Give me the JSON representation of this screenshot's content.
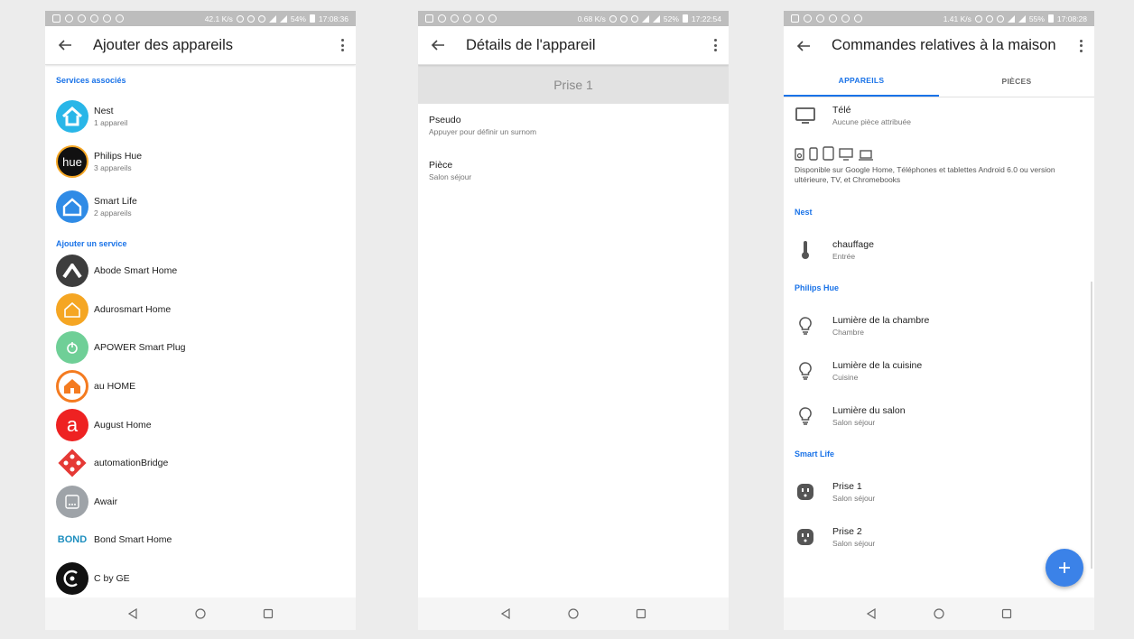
{
  "screens": [
    {
      "status": {
        "speed": "42.1 K/s",
        "battery": "54%",
        "time": "17:08:36"
      },
      "title": "Ajouter des appareils",
      "linked_header": "Services associés",
      "linked": [
        {
          "name": "Nest",
          "sub": "1 appareil",
          "logo_color": "#29b6e8"
        },
        {
          "name": "Philips Hue",
          "sub": "3 appareils",
          "logo_color": "#111111",
          "logo_text": "hue"
        },
        {
          "name": "Smart Life",
          "sub": "2 appareils",
          "logo_color": "#2f8be6"
        }
      ],
      "add_header": "Ajouter un service",
      "services": [
        {
          "name": "Abode Smart Home",
          "logo_color": "#3d3d3d"
        },
        {
          "name": "Adurosmart Home",
          "logo_color": "#f5a623"
        },
        {
          "name": "APOWER Smart Plug",
          "logo_color": "#6fcf97"
        },
        {
          "name": "au HOME",
          "logo_color": "#f47b20"
        },
        {
          "name": "August Home",
          "logo_color": "#ee2222",
          "logo_text": "a"
        },
        {
          "name": "automationBridge",
          "logo_color": "#e53935"
        },
        {
          "name": "Awair",
          "logo_color": "#9ea3a8"
        },
        {
          "name": "Bond Smart Home",
          "logo_text": "BOND",
          "logo_color": "#1f8fbf"
        },
        {
          "name": "C by GE",
          "logo_color": "#111111"
        }
      ]
    },
    {
      "status": {
        "speed": "0.68 K/s",
        "battery": "52%",
        "time": "17:22:54"
      },
      "title": "Détails de l'appareil",
      "device_name": "Prise 1",
      "rows": [
        {
          "title": "Pseudo",
          "sub": "Appuyer pour définir un surnom"
        },
        {
          "title": "Pièce",
          "sub": "Salon séjour"
        }
      ]
    },
    {
      "status": {
        "speed": "1.41 K/s",
        "battery": "55%",
        "time": "17:08:28"
      },
      "title": "Commandes relatives à la maison",
      "tabs": [
        "APPAREILS",
        "PIÈCES"
      ],
      "tv": {
        "title": "Télé",
        "sub": "Aucune pièce attribuée"
      },
      "availability": "Disponible sur Google Home, Téléphones et tablettes Android 6.0 ou version ultérieure, TV, et Chromebooks",
      "groups": [
        {
          "header": "Nest",
          "devices": [
            {
              "title": "chauffage",
              "sub": "Entrée",
              "icon": "thermometer-icon"
            }
          ]
        },
        {
          "header": "Philips Hue",
          "devices": [
            {
              "title": "Lumière de la chambre",
              "sub": "Chambre",
              "icon": "lightbulb-icon"
            },
            {
              "title": "Lumière de la cuisine",
              "sub": "Cuisine",
              "icon": "lightbulb-icon"
            },
            {
              "title": "Lumière du salon",
              "sub": "Salon séjour",
              "icon": "lightbulb-icon"
            }
          ]
        },
        {
          "header": "Smart Life",
          "devices": [
            {
              "title": "Prise 1",
              "sub": "Salon séjour",
              "icon": "outlet-icon"
            },
            {
              "title": "Prise 2",
              "sub": "Salon séjour",
              "icon": "outlet-icon"
            }
          ]
        }
      ]
    }
  ]
}
